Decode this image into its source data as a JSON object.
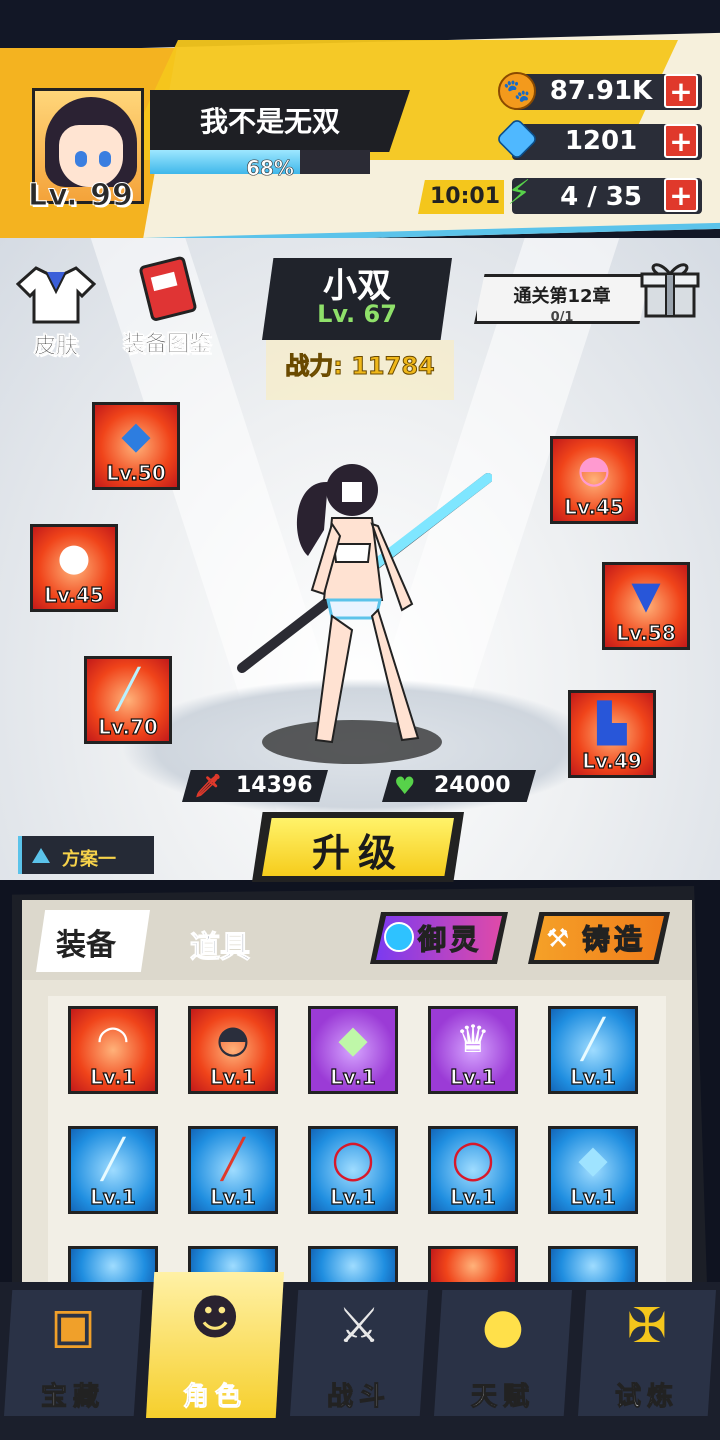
{
  "player": {
    "name": "我不是无双",
    "level": "Lv. 99",
    "exp_percent": 68,
    "exp_text": "68%"
  },
  "resources": {
    "coins": "87.91K",
    "gems": "1201",
    "timer": "10:01",
    "energy": "4 / 35",
    "coin_icon": "paw-coin-icon",
    "gem_icon": "diamond-icon",
    "energy_icon": "lightning-icon"
  },
  "side_buttons": {
    "skin": "皮肤",
    "codex": "装备图鉴"
  },
  "hero": {
    "name": "小双",
    "level": "Lv. 67",
    "power": "战力: 11784",
    "attack": "14396",
    "hp": "24000"
  },
  "quest": {
    "title": "通关第12章",
    "progress": "0/1"
  },
  "equipped": {
    "left": [
      {
        "icon": "amulet-icon",
        "level": "Lv.50",
        "style": "red"
      },
      {
        "icon": "orb-icon",
        "level": "Lv.45",
        "style": "red"
      },
      {
        "icon": "sword-icon",
        "level": "Lv.70",
        "style": "red"
      }
    ],
    "right": [
      {
        "icon": "helmet-icon",
        "level": "Lv.45",
        "style": "red"
      },
      {
        "icon": "armor-icon",
        "level": "Lv.58",
        "style": "red"
      },
      {
        "icon": "boots-icon",
        "level": "Lv.49",
        "style": "red"
      }
    ]
  },
  "upgrade": {
    "label": "升级"
  },
  "plan": {
    "label": "方案一"
  },
  "inventory": {
    "tabs": [
      "装备",
      "道具"
    ],
    "yuling": "御灵",
    "forge": "铸造",
    "rows": [
      [
        {
          "icon": "cap-icon",
          "level": "Lv.1",
          "style": "red"
        },
        {
          "icon": "helmet-icon",
          "level": "Lv.1",
          "style": "red"
        },
        {
          "icon": "crystal-icon",
          "level": "Lv.1",
          "style": "purple"
        },
        {
          "icon": "dress-icon",
          "level": "Lv.1",
          "style": "purple"
        },
        {
          "icon": "lightsaber-icon",
          "level": "Lv.1",
          "style": "blue"
        }
      ],
      [
        {
          "icon": "lightsaber-icon",
          "level": "Lv.1",
          "style": "blue"
        },
        {
          "icon": "blade-icon",
          "level": "Lv.1",
          "style": "blue"
        },
        {
          "icon": "beads-icon",
          "level": "Lv.1",
          "style": "blue"
        },
        {
          "icon": "beads-icon",
          "level": "Lv.1",
          "style": "blue"
        },
        {
          "icon": "amulet-icon",
          "level": "Lv.1",
          "style": "blue"
        }
      ]
    ]
  },
  "nav": [
    {
      "label": "宝藏",
      "icon": "chest-icon"
    },
    {
      "label": "角色",
      "icon": "character-icon"
    },
    {
      "label": "战斗",
      "icon": "swords-icon"
    },
    {
      "label": "天赋",
      "icon": "bulb-icon"
    },
    {
      "label": "试炼",
      "icon": "trial-sword-icon"
    }
  ],
  "colors": {
    "accent_yellow": "#f4c61c",
    "accent_blue": "#5bc3ea",
    "hp_green": "#57d24a",
    "atk_red": "#e0392b"
  }
}
